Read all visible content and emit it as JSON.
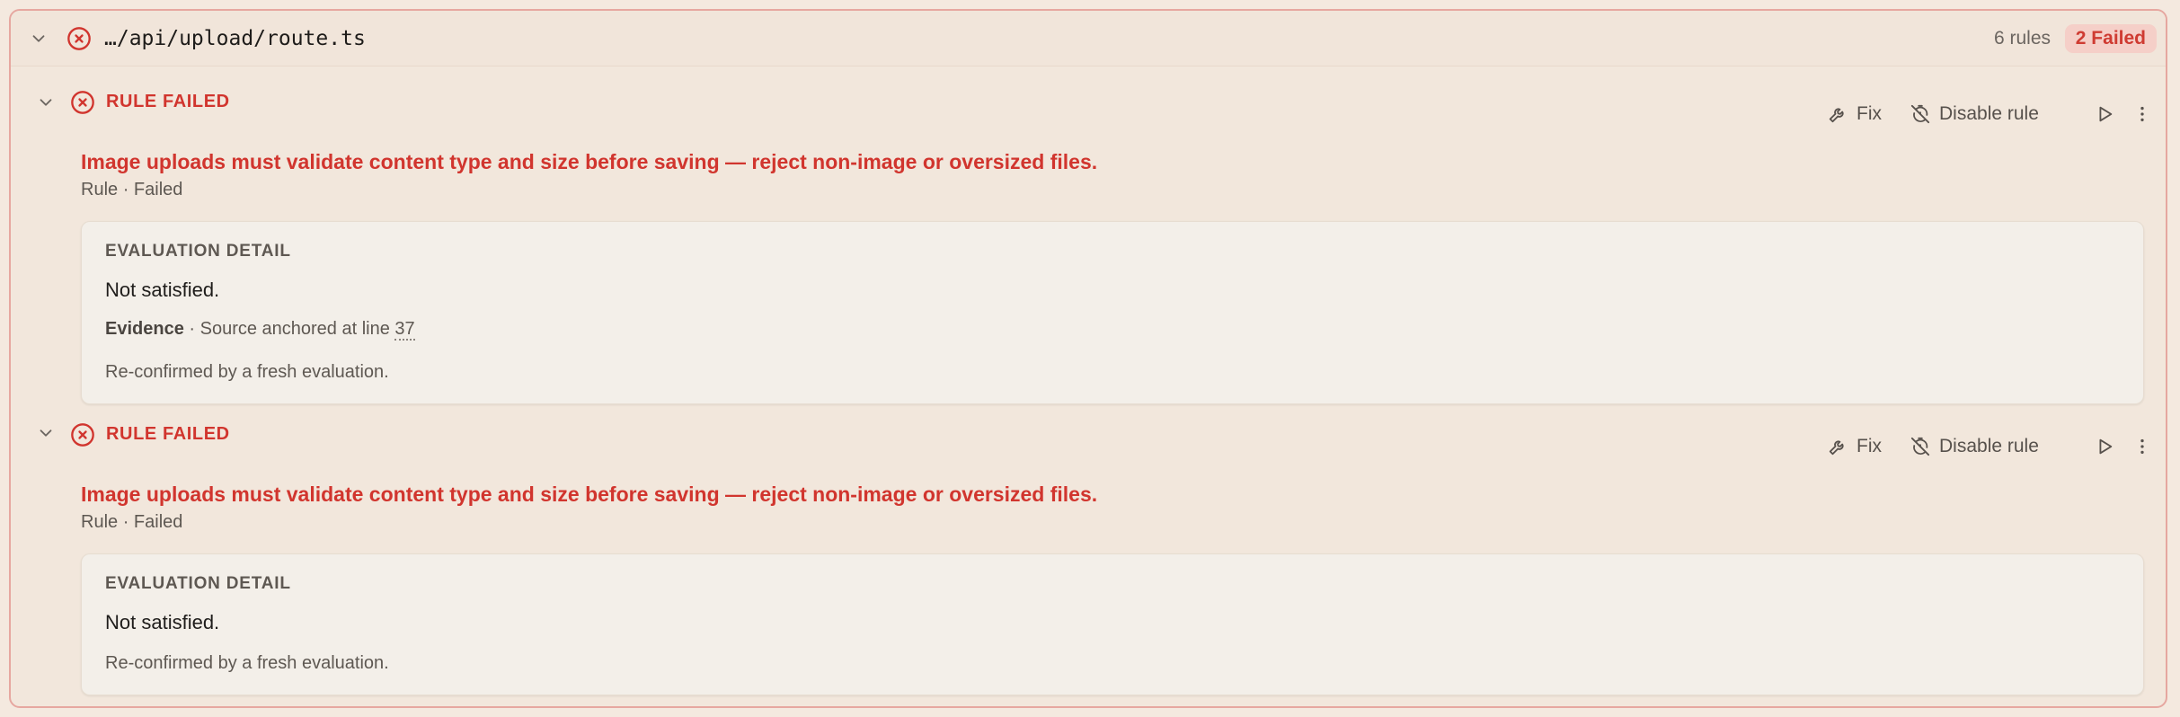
{
  "file": {
    "path": "…/api/upload/route.ts",
    "rules_count": "6 rules",
    "failed_badge": "2 Failed"
  },
  "rules": [
    {
      "status_title": "RULE FAILED",
      "fix_label": "Fix",
      "disable_label": "Disable rule",
      "description": "Image uploads must validate content type and size before saving — reject non-image or oversized files.",
      "meta": "Rule · Failed",
      "detail_heading": "EVALUATION DETAIL",
      "detail_value": "Not satisfied.",
      "evidence_label": "Evidence",
      "evidence_text": " · Source anchored at line ",
      "evidence_line": "37",
      "reconfirmed": "Re-confirmed by a fresh evaluation."
    },
    {
      "status_title": "RULE FAILED",
      "fix_label": "Fix",
      "disable_label": "Disable rule",
      "description": "Image uploads must validate content type and size before saving — reject non-image or oversized files.",
      "meta": "Rule · Failed",
      "detail_heading": "EVALUATION DETAIL",
      "detail_value": "Not satisfied.",
      "reconfirmed": "Re-confirmed by a fresh evaluation."
    }
  ],
  "colors": {
    "accent_red": "#d1352e",
    "badge_bg": "#f5cfc8",
    "panel_border": "#e6a7a0"
  },
  "icons": [
    "chevron-down-icon",
    "error-circle-icon",
    "wrench-icon",
    "timer-off-icon",
    "play-icon",
    "more-vertical-icon"
  ]
}
